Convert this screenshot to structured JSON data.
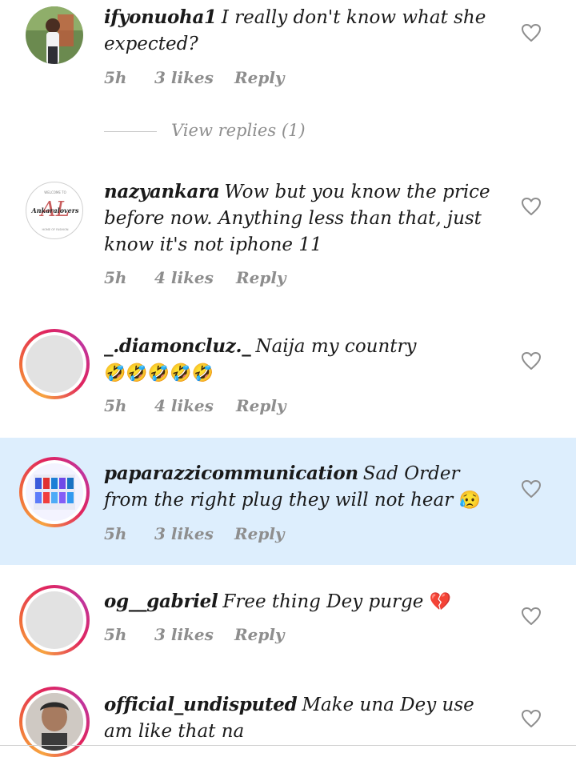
{
  "comments": [
    {
      "username": "ifyonuoha1",
      "text": "I really don't know what she expected?",
      "time": "5h",
      "likes": "3 likes",
      "reply": "Reply",
      "view_replies": "View replies (1)"
    },
    {
      "username": "nazyankara",
      "text": "Wow but you know the price before now. Anything less than that, just know it's not iphone 11",
      "time": "5h",
      "likes": "4 likes",
      "reply": "Reply",
      "avatar_logo_text": "Ankaralovers"
    },
    {
      "username": "_.diamoncluz._",
      "text": "Naija my country",
      "emojis": "🤣🤣🤣🤣🤣",
      "time": "5h",
      "likes": "4 likes",
      "reply": "Reply"
    },
    {
      "username": "paparazzicommunication",
      "text": "Sad Order from the right plug they will not hear",
      "emojis": "😥",
      "time": "5h",
      "likes": "3 likes",
      "reply": "Reply"
    },
    {
      "username": "og__gabriel",
      "text": "Free thing Dey purge",
      "emojis": "💔",
      "time": "5h",
      "likes": "3 likes",
      "reply": "Reply"
    },
    {
      "username": "official_undisputed",
      "text": "Make una Dey use am like that na"
    }
  ],
  "colors": {
    "highlight": "#ddeefd",
    "meta_text": "#8e8e8e",
    "heart_stroke": "#8e8e8e"
  },
  "icons": {
    "like": "heart-outline-icon"
  }
}
